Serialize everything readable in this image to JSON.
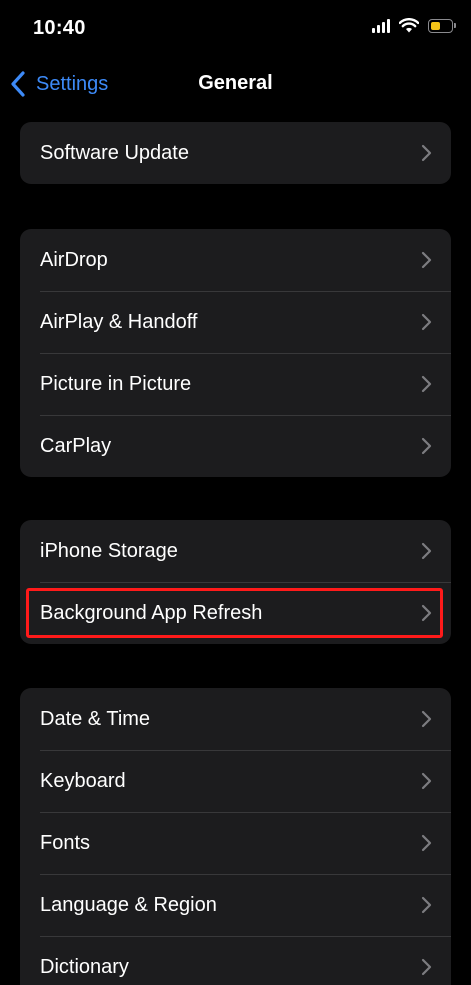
{
  "status_bar": {
    "time": "10:40",
    "battery_level": 0.45,
    "battery_color": "#f5c518",
    "icons": [
      "cellular-signal-icon",
      "wifi-icon",
      "battery-icon"
    ]
  },
  "nav": {
    "back_label": "Settings",
    "title": "General",
    "accent_color": "#3d8af7"
  },
  "groups": [
    {
      "items": [
        {
          "label": "Software Update"
        }
      ]
    },
    {
      "items": [
        {
          "label": "AirDrop"
        },
        {
          "label": "AirPlay & Handoff"
        },
        {
          "label": "Picture in Picture"
        },
        {
          "label": "CarPlay"
        }
      ]
    },
    {
      "items": [
        {
          "label": "iPhone Storage"
        },
        {
          "label": "Background App Refresh",
          "highlighted": true
        }
      ]
    },
    {
      "items": [
        {
          "label": "Date & Time"
        },
        {
          "label": "Keyboard"
        },
        {
          "label": "Fonts"
        },
        {
          "label": "Language & Region"
        },
        {
          "label": "Dictionary"
        }
      ]
    }
  ],
  "highlight_color": "#ff1a1a"
}
